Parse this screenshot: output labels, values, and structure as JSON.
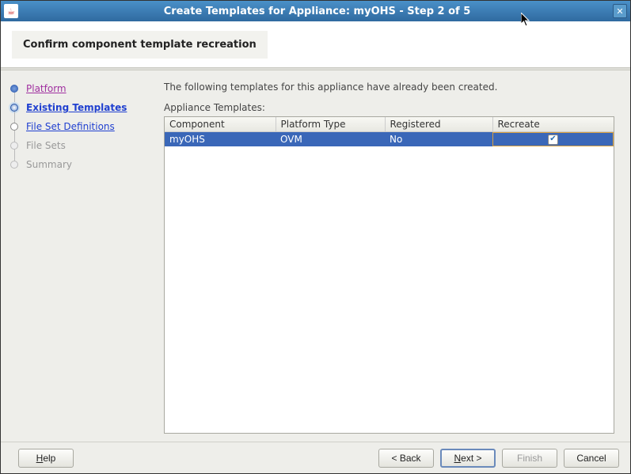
{
  "titlebar": {
    "java_icon_glyph": "☕",
    "title": "Create Templates for Appliance: myOHS - Step 2 of 5",
    "close_glyph": "✕"
  },
  "header": {
    "subtitle": "Confirm component template recreation"
  },
  "sidebar": {
    "items": [
      {
        "label": "Platform",
        "state": "done"
      },
      {
        "label": "Existing Templates",
        "state": "current"
      },
      {
        "label": "File Set Definitions",
        "state": "active-link"
      },
      {
        "label": "File Sets",
        "state": "pending"
      },
      {
        "label": "Summary",
        "state": "pending"
      }
    ]
  },
  "main": {
    "intro": "The following templates for this appliance have already been created.",
    "table_label": "Appliance Templates:",
    "columns": {
      "component": "Component",
      "platform_type": "Platform Type",
      "registered": "Registered",
      "recreate": "Recreate"
    },
    "rows": [
      {
        "component": "myOHS",
        "platform_type": "OVM",
        "registered": "No",
        "recreate_checked": true
      }
    ]
  },
  "footer": {
    "help": "Help",
    "back": "< Back",
    "next_prefix": "N",
    "next_rest": "ext >",
    "finish": "Finish",
    "cancel": "Cancel"
  }
}
